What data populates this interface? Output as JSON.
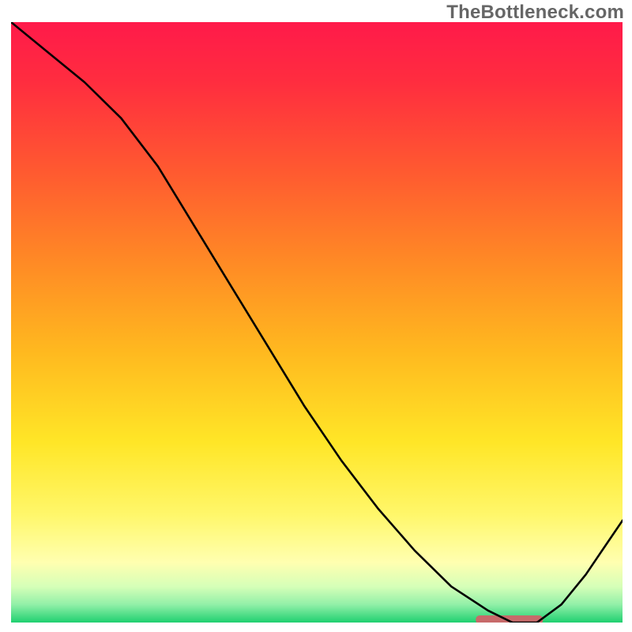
{
  "watermark": "TheBottleneck.com",
  "chart_data": {
    "type": "line",
    "title": "",
    "xlabel": "",
    "ylabel": "",
    "xlim": [
      0,
      100
    ],
    "ylim": [
      0,
      100
    ],
    "x": [
      0,
      6,
      12,
      18,
      24,
      30,
      36,
      42,
      48,
      54,
      60,
      66,
      72,
      78,
      82,
      86,
      90,
      94,
      98,
      100
    ],
    "values": [
      100,
      95,
      90,
      84,
      76,
      66,
      56,
      46,
      36,
      27,
      19,
      12,
      6,
      2,
      0,
      0,
      3,
      8,
      14,
      17
    ],
    "gradient_stops": [
      {
        "offset": 0.0,
        "color": "#ff1a4a"
      },
      {
        "offset": 0.1,
        "color": "#ff2d3f"
      },
      {
        "offset": 0.25,
        "color": "#ff5a30"
      },
      {
        "offset": 0.4,
        "color": "#ff8a25"
      },
      {
        "offset": 0.55,
        "color": "#ffb91f"
      },
      {
        "offset": 0.7,
        "color": "#ffe627"
      },
      {
        "offset": 0.82,
        "color": "#fff76a"
      },
      {
        "offset": 0.9,
        "color": "#ffffb0"
      },
      {
        "offset": 0.94,
        "color": "#d6ffb8"
      },
      {
        "offset": 0.97,
        "color": "#92f0a8"
      },
      {
        "offset": 1.0,
        "color": "#20d070"
      }
    ],
    "marker": {
      "x_start": 76,
      "x_end": 87,
      "y": 0,
      "color": "#c76a6a"
    },
    "line_color": "#000000",
    "line_width": 2.6
  }
}
